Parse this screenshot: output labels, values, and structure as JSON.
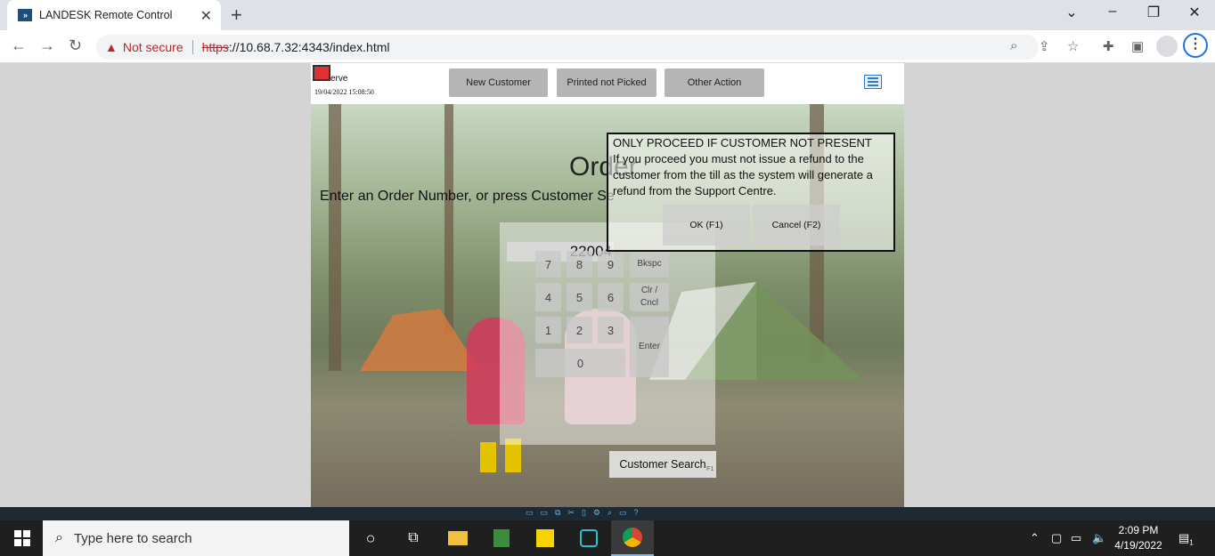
{
  "browser": {
    "tab_title": "LANDESK Remote Control",
    "tab_icon": "landesk-icon",
    "security_label": "Not secure",
    "url_scheme": "https",
    "url_rest": "://10.68.7.32:4343/index.html"
  },
  "header": {
    "logo_text": "erve",
    "datetime": "19/04/2022 15:08:50",
    "buttons": [
      "New Customer",
      "Printed not Picked",
      "Other Action"
    ]
  },
  "main": {
    "title": "Order",
    "instructions": "Enter an Order Number, or press Customer Se",
    "order_value": "22004",
    "keys": [
      "7",
      "8",
      "9",
      "Bkspc",
      "4",
      "5",
      "6",
      "Clr / Cncl",
      "1",
      "2",
      "3",
      "Enter",
      "0"
    ],
    "customer_search": "Customer Search",
    "customer_search_hint": "F1"
  },
  "dialog": {
    "title": "ONLY PROCEED IF CUSTOMER NOT PRESENT",
    "body": "If you proceed you must not issue a refund to the customer from the till as the system will generate a refund from the Support Centre.",
    "ok_label": "OK (F1)",
    "cancel_label": "Cancel (F2)"
  },
  "taskbar": {
    "search_placeholder": "Type here to search",
    "time": "2:09 PM",
    "date": "4/19/2022",
    "notification_count": "1"
  }
}
